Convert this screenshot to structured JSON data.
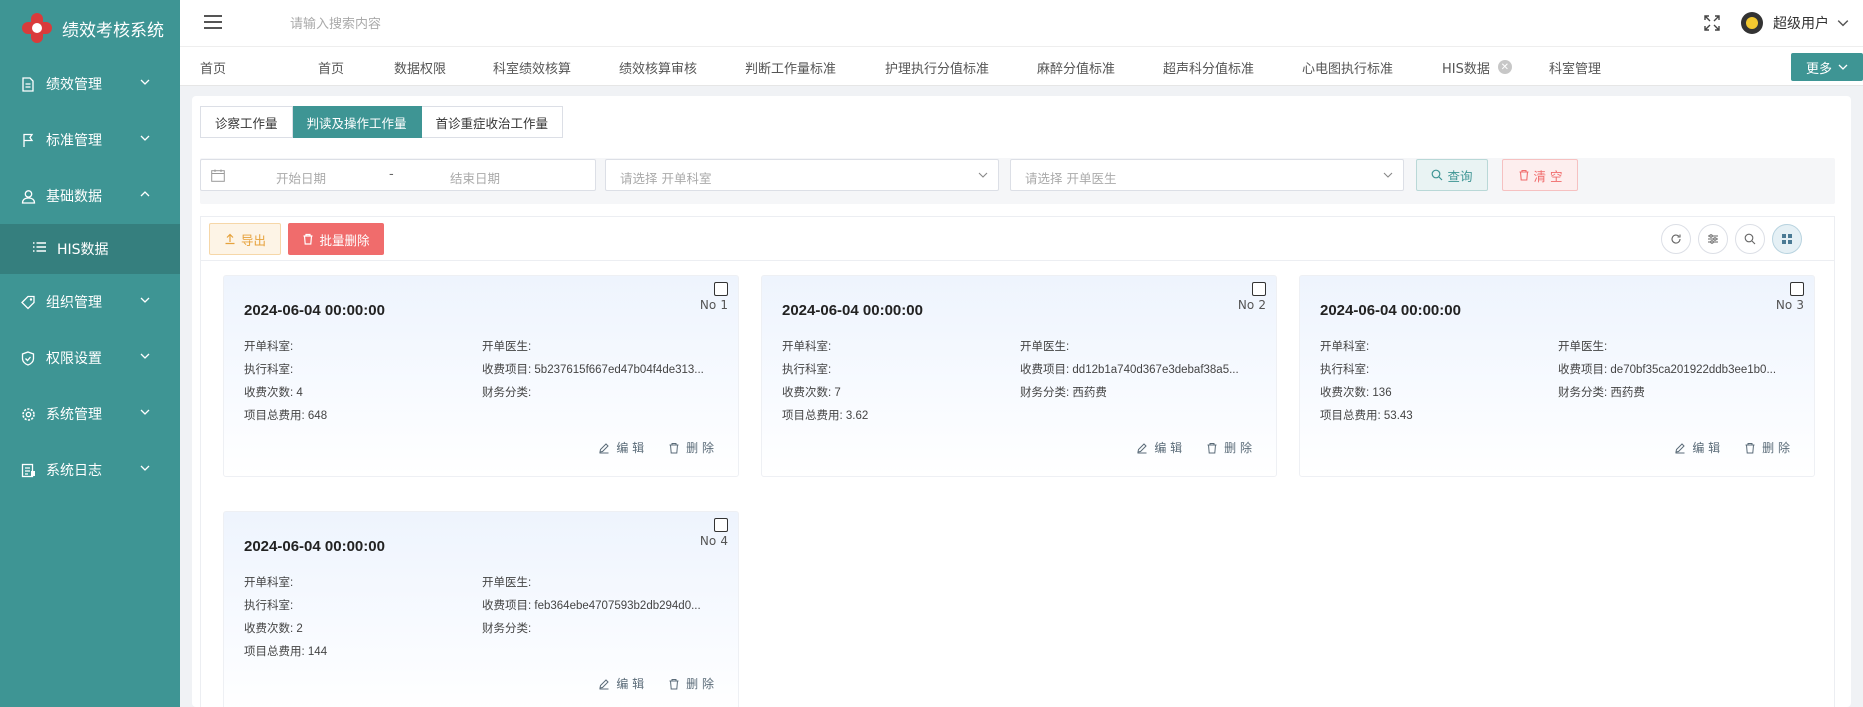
{
  "app": {
    "title": "绩效考核系统",
    "brand_color": "#3e9594"
  },
  "sidebar": {
    "items": [
      {
        "label": "绩效管理",
        "icon": "document-icon"
      },
      {
        "label": "标准管理",
        "icon": "flag-icon"
      },
      {
        "label": "基础数据",
        "icon": "user-icon",
        "expanded": true
      },
      {
        "label": "组织管理",
        "icon": "tag-icon"
      },
      {
        "label": "权限设置",
        "icon": "shield-icon"
      },
      {
        "label": "系统管理",
        "icon": "gear-icon"
      },
      {
        "label": "系统日志",
        "icon": "log-icon"
      }
    ],
    "sub_item": {
      "label": "HIS数据",
      "icon": "list-icon"
    }
  },
  "header": {
    "search_placeholder": "请输入搜索内容",
    "user": "超级用户"
  },
  "tabbar": {
    "tabs": [
      "首页",
      "首页",
      "数据权限",
      "科室绩效核算",
      "绩效核算审核",
      "判断工作量标准",
      "护理执行分值标准",
      "麻醉分值标准",
      "超声科分值标准",
      "心电图执行标准",
      "HIS数据",
      "科室管理"
    ],
    "active_tab": "HIS数据",
    "more": "更多"
  },
  "subtabs": [
    "诊察工作量",
    "判读及操作工作量",
    "首诊重症收治工作量"
  ],
  "subtabs_active": "判读及操作工作量",
  "filter": {
    "start_placeholder": "开始日期",
    "separator": "-",
    "end_placeholder": "结束日期",
    "dept_placeholder": "请选择 开单科室",
    "doctor_placeholder": "请选择 开单医生",
    "query": "查询",
    "clear": "清 空"
  },
  "toolbar": {
    "export": "导出",
    "batch_delete": "批量删除"
  },
  "labels": {
    "order_dept": "开单科室:",
    "order_doctor": "开单医生:",
    "exec_dept": "执行科室:",
    "charge_item": "收费项目:",
    "charge_count": "收费次数:",
    "finance_cat": "财务分类:",
    "total_fee": "项目总费用:",
    "no": "No",
    "edit": "编 辑",
    "delete": "删 除"
  },
  "cards": [
    {
      "no": "1",
      "date": "2024-06-04 00:00:00",
      "order_dept": "",
      "order_doctor": "",
      "exec_dept": "",
      "charge_item": "5b237615f667ed47b04f4de313...",
      "charge_count": "4",
      "finance_cat": "",
      "total_fee": "648"
    },
    {
      "no": "2",
      "date": "2024-06-04 00:00:00",
      "order_dept": "",
      "order_doctor": "",
      "exec_dept": "",
      "charge_item": "dd12b1a740d367e3debaf38a5...",
      "charge_count": "7",
      "finance_cat": "西药费",
      "total_fee": "3.62"
    },
    {
      "no": "3",
      "date": "2024-06-04 00:00:00",
      "order_dept": "",
      "order_doctor": "",
      "exec_dept": "",
      "charge_item": "de70bf35ca201922ddb3ee1b0...",
      "charge_count": "136",
      "finance_cat": "西药费",
      "total_fee": "53.43"
    },
    {
      "no": "4",
      "date": "2024-06-04 00:00:00",
      "order_dept": "",
      "order_doctor": "",
      "exec_dept": "",
      "charge_item": "feb364ebe4707593b2db294d0...",
      "charge_count": "2",
      "finance_cat": "",
      "total_fee": "144"
    }
  ]
}
